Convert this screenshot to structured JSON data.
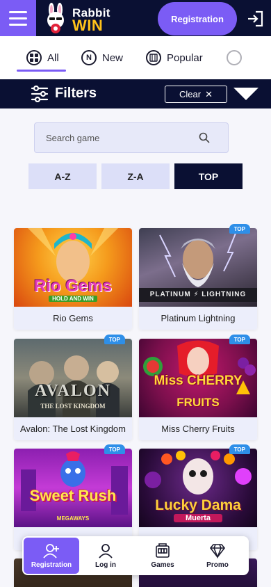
{
  "header": {
    "brand_line1": "Rabbit",
    "brand_line2": "WIN",
    "registration_label": "Registration"
  },
  "tabs": [
    {
      "label": "All",
      "icon": "grid-icon",
      "active": true
    },
    {
      "label": "New",
      "icon": "new-badge-icon"
    },
    {
      "label": "Popular",
      "icon": "popular-icon"
    }
  ],
  "filters": {
    "label": "Filters",
    "clear_label": "Clear",
    "clear_icon": "✕"
  },
  "search": {
    "placeholder": "Search game"
  },
  "sort": {
    "az": "A-Z",
    "za": "Z-A",
    "top": "TOP",
    "selected": "TOP"
  },
  "games": [
    {
      "title": "Rio Gems",
      "art": "Rio Gems",
      "art_sub": "HOLD AND WIN",
      "badge": ""
    },
    {
      "title": "Platinum Lightning",
      "art": "PLATINUM",
      "art_sub": "LIGHTNING",
      "badge": "TOP"
    },
    {
      "title": "Avalon: The Lost Kingdom",
      "art": "AVALON",
      "art_sub": "THE LOST KINGDOM",
      "badge": "TOP"
    },
    {
      "title": "Miss Cherry Fruits",
      "art": "Miss CHERRY",
      "art_sub": "FRUITS",
      "badge": "TOP"
    },
    {
      "title": "",
      "art": "Sweet Rush",
      "art_sub": "MEGAWAYS",
      "badge": "TOP"
    },
    {
      "title": "",
      "art": "Lucky Dama",
      "art_sub": "Muerta",
      "badge": "TOP"
    }
  ],
  "bottom_nav": [
    {
      "label": "Registration",
      "icon": "add-user-icon",
      "active": true
    },
    {
      "label": "Log in",
      "icon": "user-icon"
    },
    {
      "label": "Games",
      "icon": "slot-machine-icon"
    },
    {
      "label": "Promo",
      "icon": "diamond-icon"
    }
  ],
  "colors": {
    "brand_purple": "#7b5cf5",
    "navy": "#0a1033",
    "gold": "#ffc21a",
    "top_badge": "#2e8fe8"
  }
}
